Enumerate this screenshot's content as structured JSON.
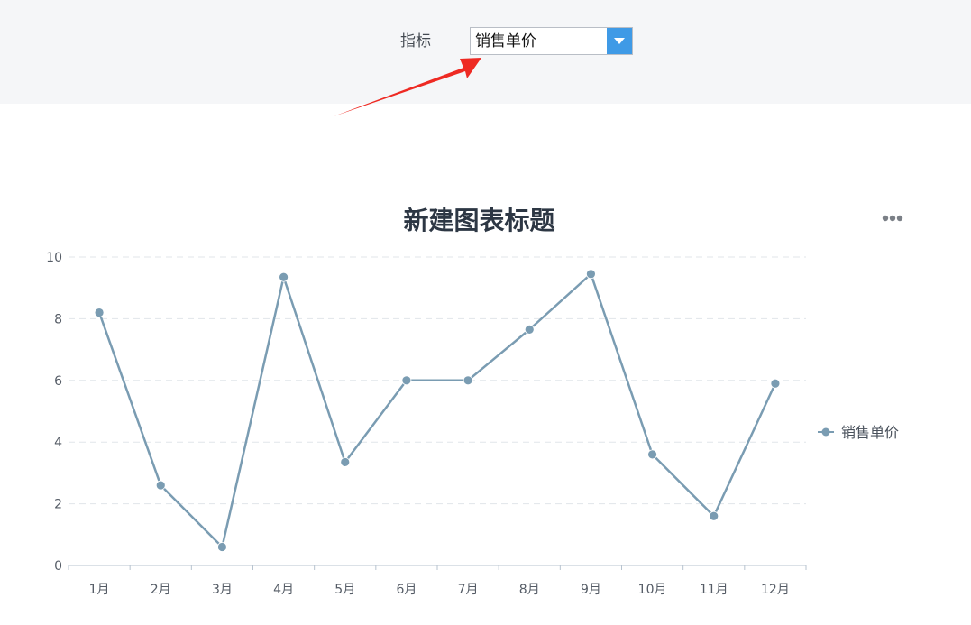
{
  "filter": {
    "label": "指标",
    "selected": "销售单价"
  },
  "chart_data": {
    "type": "line",
    "title": "新建图表标题",
    "categories": [
      "1月",
      "2月",
      "3月",
      "4月",
      "5月",
      "6月",
      "7月",
      "8月",
      "9月",
      "10月",
      "11月",
      "12月"
    ],
    "series": [
      {
        "name": "销售单价",
        "values": [
          8.2,
          2.6,
          0.6,
          9.35,
          3.35,
          6.0,
          6.0,
          7.65,
          9.45,
          3.6,
          1.6,
          5.9
        ]
      }
    ],
    "ylim": [
      0,
      10
    ],
    "yticks": [
      0,
      2,
      4,
      6,
      8,
      10
    ],
    "grid": true,
    "legend_position": "right",
    "colors": {
      "series": "#7a9cb2",
      "grid": "#e1e5ea",
      "axis": "#b7c3cf",
      "title": "#2d3744",
      "dropdown_accent": "#3f9ae6",
      "annotation": "#ee2a23"
    }
  }
}
